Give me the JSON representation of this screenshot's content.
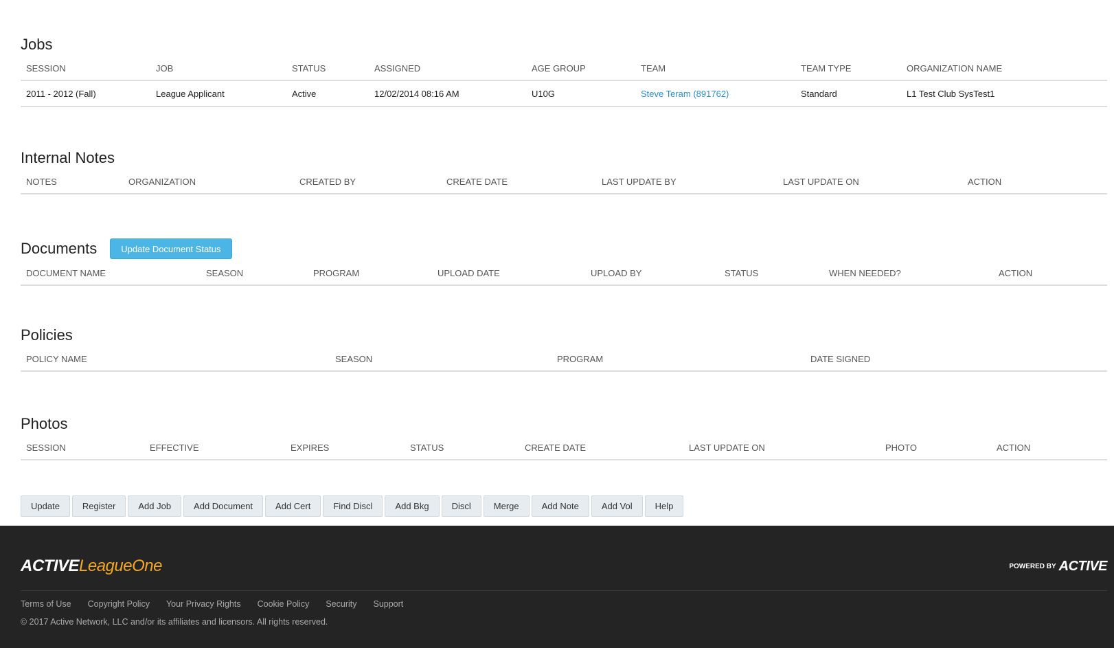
{
  "jobs": {
    "title": "Jobs",
    "columns": [
      "SESSION",
      "JOB",
      "STATUS",
      "ASSIGNED",
      "AGE GROUP",
      "TEAM",
      "TEAM TYPE",
      "ORGANIZATION NAME"
    ],
    "row": {
      "session": "2011 - 2012 (Fall)",
      "job": "League Applicant",
      "status": "Active",
      "assigned": "12/02/2014 08:16 AM",
      "age_group": "U10G",
      "team": "Steve Teram (891762)",
      "team_type": "Standard",
      "organization": "L1 Test Club SysTest1"
    }
  },
  "internal_notes": {
    "title": "Internal Notes",
    "columns": [
      "NOTES",
      "ORGANIZATION",
      "CREATED BY",
      "CREATE DATE",
      "LAST UPDATE BY",
      "LAST UPDATE ON",
      "ACTION"
    ]
  },
  "documents": {
    "title": "Documents",
    "update_button": "Update Document Status",
    "columns": [
      "DOCUMENT NAME",
      "SEASON",
      "PROGRAM",
      "UPLOAD DATE",
      "UPLOAD BY",
      "STATUS",
      "WHEN NEEDED?",
      "ACTION"
    ]
  },
  "policies": {
    "title": "Policies",
    "columns": [
      "POLICY NAME",
      "SEASON",
      "PROGRAM",
      "DATE SIGNED"
    ]
  },
  "photos": {
    "title": "Photos",
    "columns": [
      "SESSION",
      "EFFECTIVE",
      "EXPIRES",
      "STATUS",
      "CREATE DATE",
      "LAST UPDATE ON",
      "PHOTO",
      "ACTION"
    ]
  },
  "actions": [
    "Update",
    "Register",
    "Add Job",
    "Add Document",
    "Add Cert",
    "Find Discl",
    "Add Bkg",
    "Discl",
    "Merge",
    "Add Note",
    "Add Vol",
    "Help"
  ],
  "footer": {
    "logo_part1": "ACTIVE",
    "logo_part2": "LeagueOne",
    "powered_by": "POWERED BY",
    "powered_brand": "ACTIVE",
    "links": [
      "Terms of Use",
      "Copyright Policy",
      "Your Privacy Rights",
      "Cookie Policy",
      "Security",
      "Support"
    ],
    "copyright": "©  2017  Active Network, LLC and/or its affiliates and licensors. All rights reserved."
  },
  "colors": {
    "link": "#2a8fc6",
    "primary_button": "#4bb6e5",
    "footer_bg": "#242424",
    "logo_accent": "#f5a623"
  }
}
